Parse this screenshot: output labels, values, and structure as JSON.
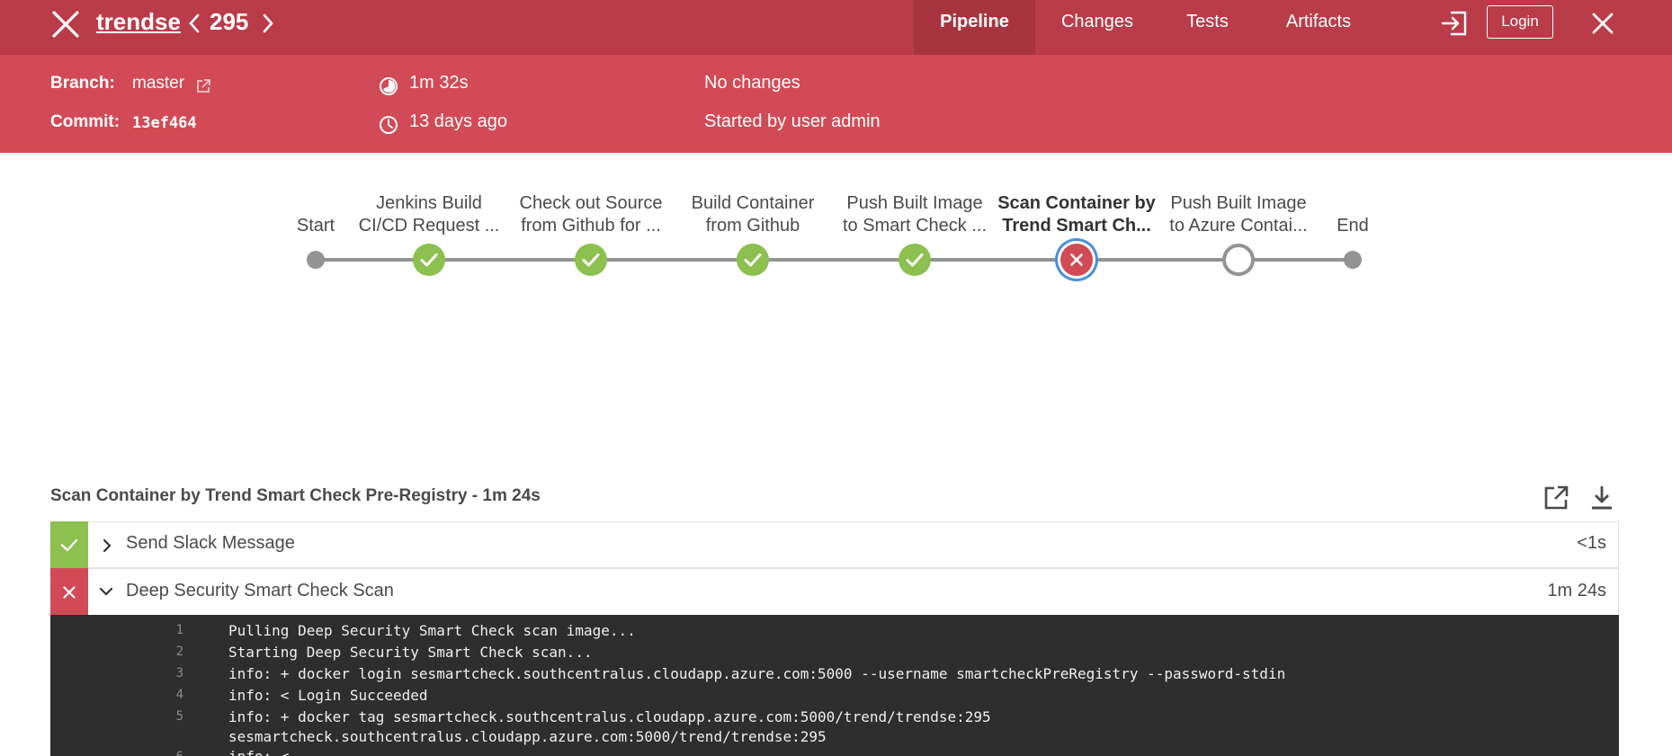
{
  "header": {
    "job_name": "trendse",
    "build_number": "295",
    "tabs": [
      {
        "label": "Pipeline"
      },
      {
        "label": "Changes"
      },
      {
        "label": "Tests"
      },
      {
        "label": "Artifacts"
      }
    ],
    "login_label": "Login"
  },
  "info": {
    "branch_label": "Branch:",
    "branch_value": "master",
    "commit_label": "Commit:",
    "commit_value": "13ef464",
    "duration": "1m 32s",
    "time_ago": "13 days ago",
    "changes": "No changes",
    "started_by": "Started by user admin"
  },
  "pipeline": {
    "stages": [
      {
        "line1": "",
        "line2": "Start",
        "status": "endpoint"
      },
      {
        "line1": "Jenkins Build",
        "line2": "CI/CD Request ...",
        "status": "success"
      },
      {
        "line1": "Check out Source",
        "line2": "from Github for ...",
        "status": "success"
      },
      {
        "line1": "Build Container",
        "line2": "from Github",
        "status": "success"
      },
      {
        "line1": "Push Built Image",
        "line2": "to Smart Check ...",
        "status": "success"
      },
      {
        "line1": "Scan Container by",
        "line2": "Trend Smart Ch...",
        "status": "failed"
      },
      {
        "line1": "Push Built Image",
        "line2": "to Azure Contai...",
        "status": "not_built"
      },
      {
        "line1": "",
        "line2": "End",
        "status": "endpoint"
      }
    ]
  },
  "detail": {
    "title": "Scan Container by Trend Smart Check Pre-Registry - 1m 24s",
    "steps": [
      {
        "label": "Send Slack Message",
        "duration": "<1s",
        "status": "success"
      },
      {
        "label": "Deep Security Smart Check Scan",
        "duration": "1m 24s",
        "status": "failed"
      }
    ],
    "log": [
      {
        "num": "1",
        "text": "Pulling Deep Security Smart Check scan image..."
      },
      {
        "num": "2",
        "text": "Starting Deep Security Smart Check scan..."
      },
      {
        "num": "3",
        "text": "info: + docker login sesmartcheck.southcentralus.cloudapp.azure.com:5000 --username smartcheckPreRegistry --password-stdin"
      },
      {
        "num": "4",
        "text": "info: < Login Succeeded"
      },
      {
        "num": "5",
        "text": "info: + docker tag sesmartcheck.southcentralus.cloudapp.azure.com:5000/trend/trendse:295"
      },
      {
        "num": "",
        "text": "sesmartcheck.southcentralus.cloudapp.azure.com:5000/trend/trendse:295"
      },
      {
        "num": "6",
        "text": "info: <"
      }
    ]
  },
  "colors": {
    "header_bg": "#b93c48",
    "info_bg": "#d24a55",
    "success": "#8cc04f",
    "failure": "#d24a55",
    "selected_ring": "#4a90d9",
    "log_bg": "#2e2e2e"
  }
}
